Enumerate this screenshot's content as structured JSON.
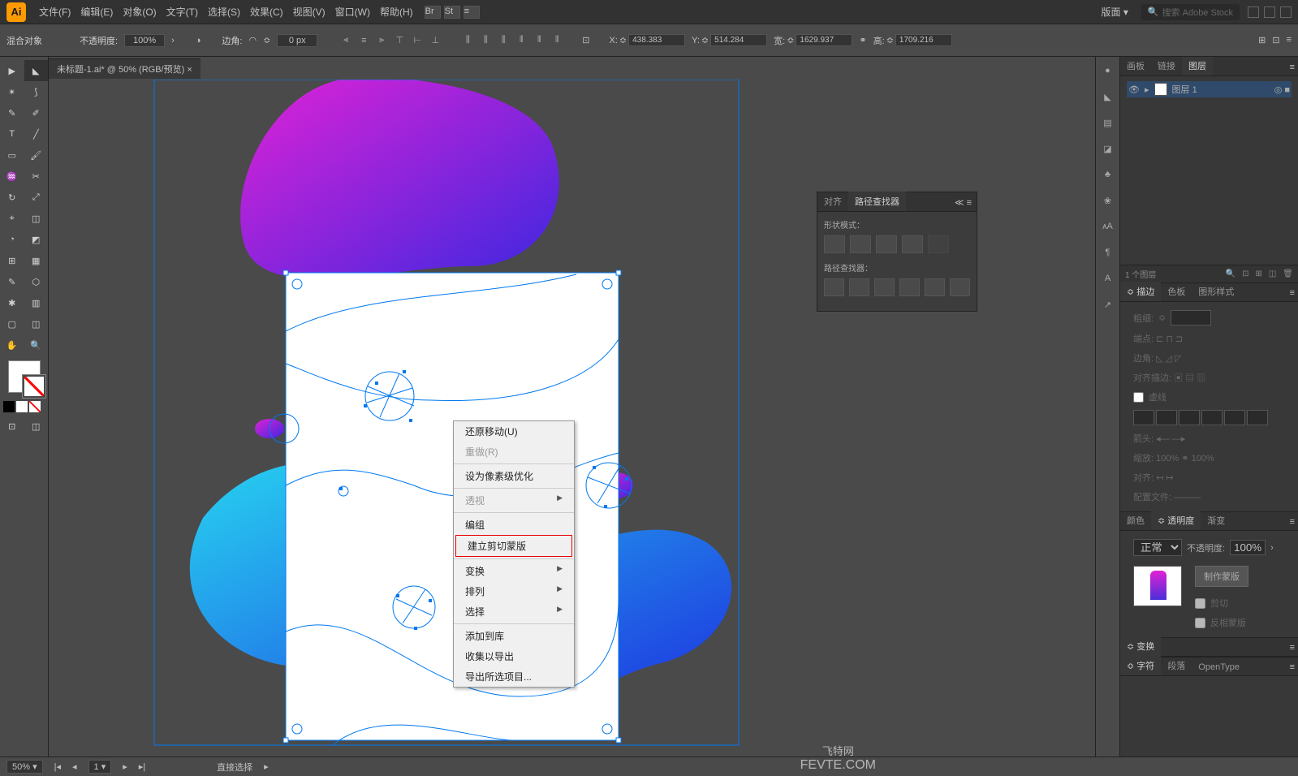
{
  "app": {
    "name": "Ai"
  },
  "menubar": {
    "file": "文件(F)",
    "edit": "编辑(E)",
    "object": "对象(O)",
    "type": "文字(T)",
    "select": "选择(S)",
    "effect": "效果(C)",
    "view": "视图(V)",
    "window": "窗口(W)",
    "help": "帮助(H)"
  },
  "top_right": {
    "layout": "版面",
    "search_ph": "搜索 Adobe Stock"
  },
  "controlbar": {
    "blend_obj": "混合对象",
    "opacity_label": "不透明度:",
    "opacity": "100%",
    "edge_label": "边角:",
    "edge_value": "0 px",
    "x_label": "X:",
    "x": "438.383",
    "y_label": "Y:",
    "y": "514.284",
    "w_label": "宽:",
    "w": "1629.937",
    "h_label": "高:",
    "h": "1709.216"
  },
  "doc_tab": "未标题-1.ai* @ 50% (RGB/预览)",
  "floater": {
    "tab_align": "对齐",
    "tab_pathfinder": "路径查找器",
    "shape_mode": "形状模式：",
    "pathfinders": "路径查找器："
  },
  "ctx": {
    "undo": "还原移动(U)",
    "redo": "重做(R)",
    "pixel_opt": "设为像素级优化",
    "perspective": "透视",
    "edit": "编组",
    "make_clip": "建立剪切蒙版",
    "transform": "变换",
    "arrange": "排列",
    "select": "选择",
    "add_lib": "添加到库",
    "collect_export": "收集以导出",
    "export_sel": "导出所选项目..."
  },
  "right_tabs": {
    "artboards": "画板",
    "links": "链接",
    "layers": "图层",
    "layer1": "图层 1",
    "layer_count": "1 个图层",
    "stroke": "描边",
    "swatches": "色板",
    "gstyle": "图形样式",
    "weight_lbl": "粗细:",
    "dash_lbl": "虚线",
    "color": "颜色",
    "transparency": "透明度",
    "gradient": "渐变",
    "blend_normal": "正常",
    "t_opacity_lbl": "不透明度:",
    "t_opacity": "100%",
    "make_mask": "制作蒙版",
    "clip_opt": "剪切",
    "invert_opt": "反相蒙版",
    "transform_tab": "变换",
    "char_tab": "字符",
    "para_tab": "段落",
    "opentype_tab": "OpenType"
  },
  "statusbar": {
    "zoom": "50%",
    "page": "1",
    "tool": "直接选择"
  },
  "watermark": {
    "cn": "飞特网",
    "en": "FEVTE.COM"
  }
}
